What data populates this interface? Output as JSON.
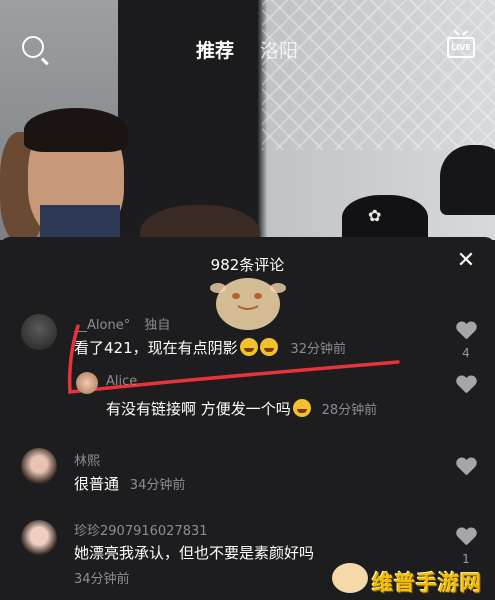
{
  "top_bar": {
    "tab_recommend": "推荐",
    "tab_city": "洛阳",
    "live_label": "LIVE"
  },
  "comments_panel": {
    "title": "982条评论",
    "comments": [
      {
        "user": "__Alone°",
        "tag": "独自",
        "text": "看了421，现在有点阴影",
        "time": "32分钟前",
        "likes": "4"
      },
      {
        "user": "Alice",
        "text": "有没有链接啊 方便发一个吗",
        "time": "28分钟前"
      },
      {
        "user": "林熙",
        "text": "很普通",
        "time": "34分钟前"
      },
      {
        "user": "珍珍2907916027831",
        "text": "她漂亮我承认，但也不要是素颜好吗",
        "time": "34分钟前",
        "likes": "1"
      }
    ]
  },
  "watermark": {
    "text": "维普手游网"
  },
  "colors": {
    "panel_bg": "#1d1d1f",
    "annotation_red": "#e8333a",
    "muted_text": "#8d8d90"
  }
}
